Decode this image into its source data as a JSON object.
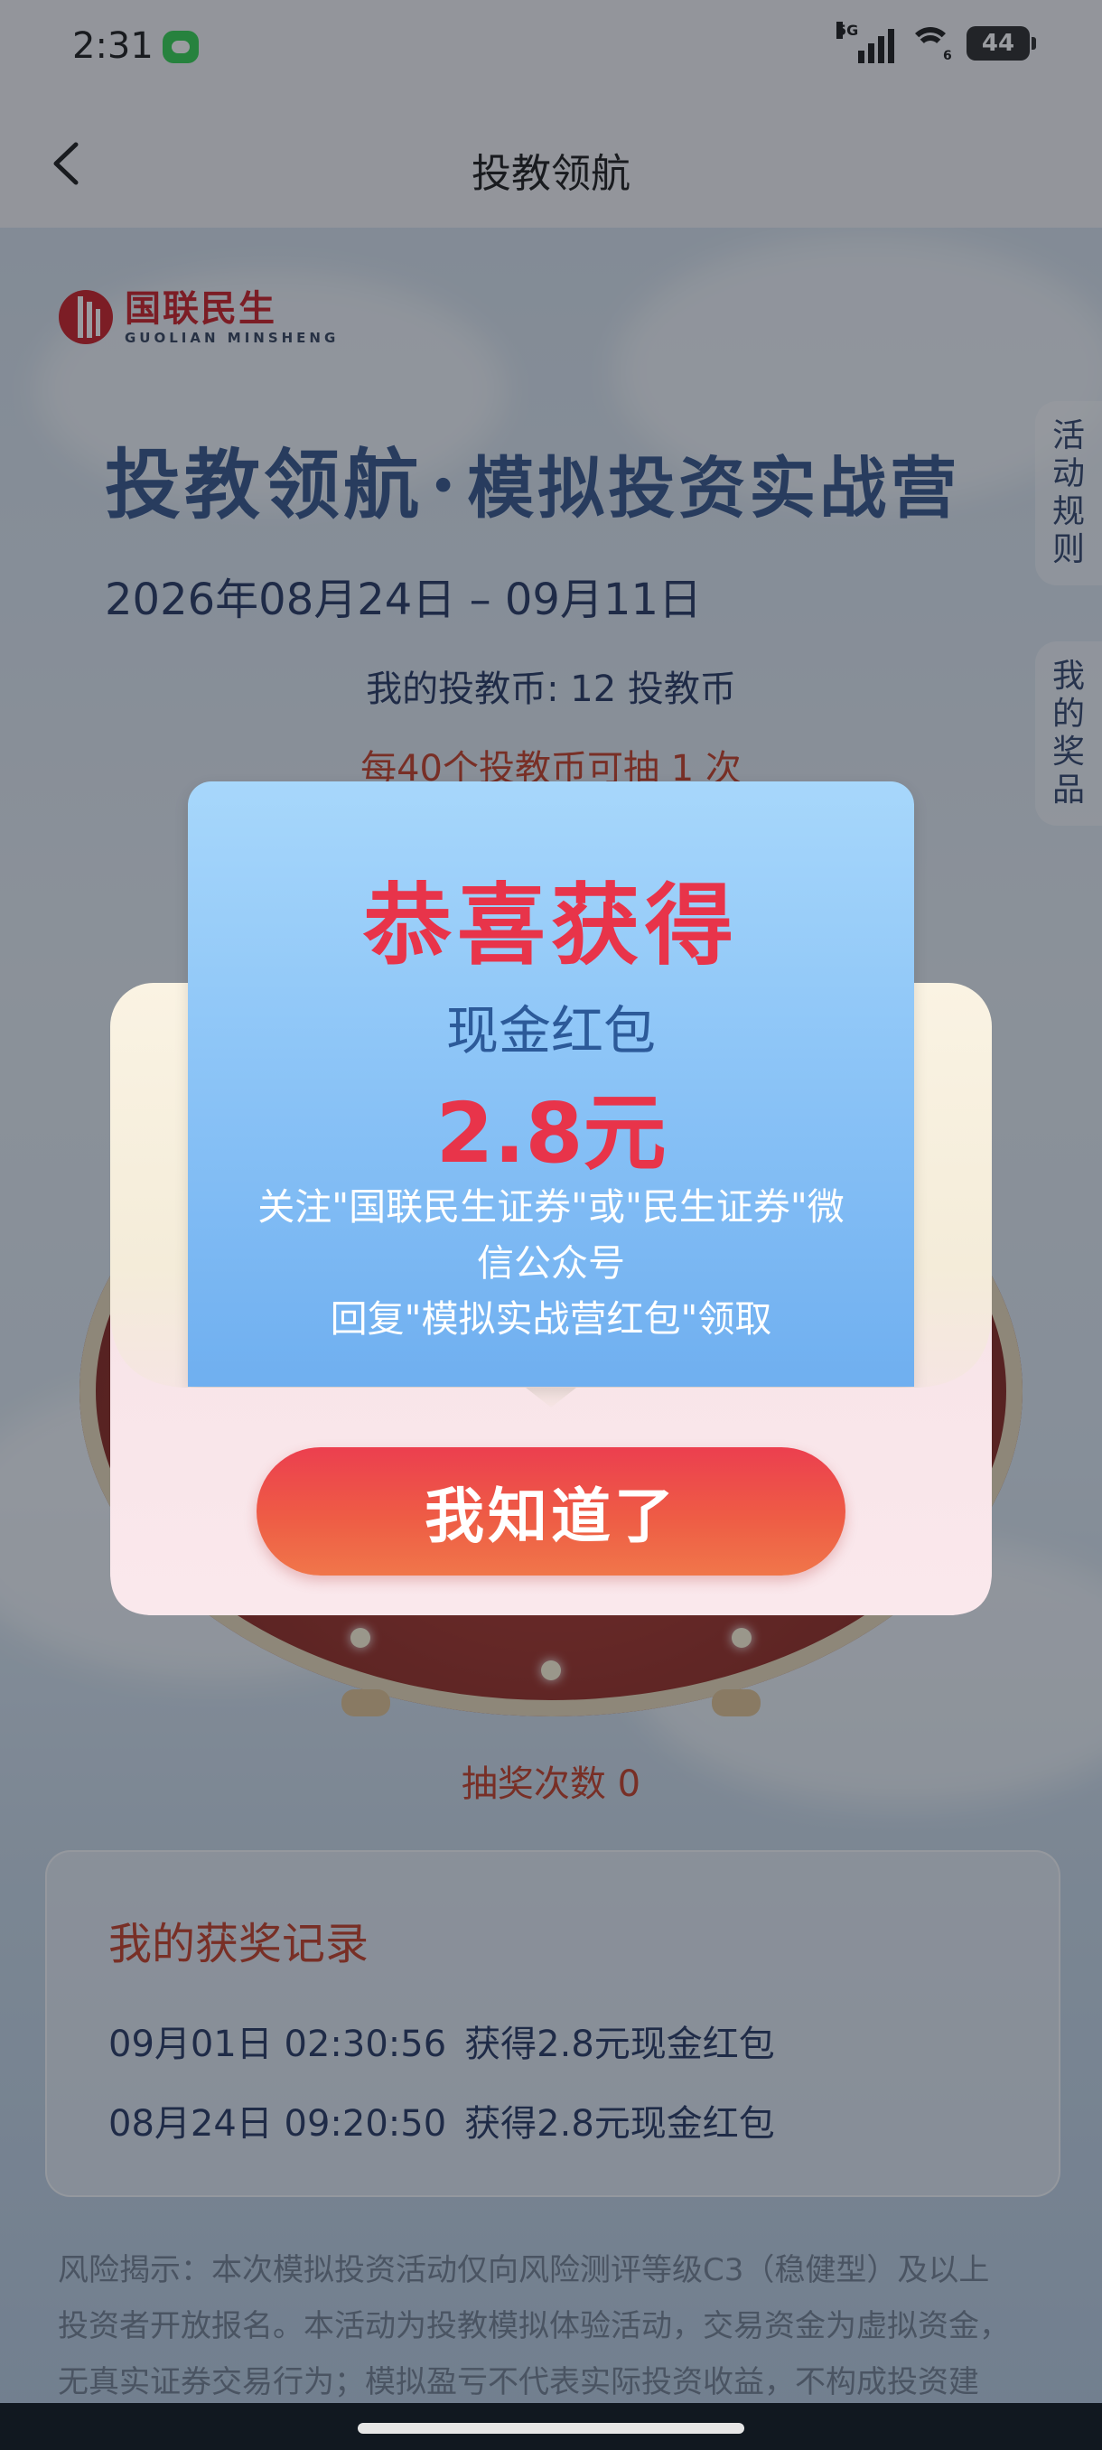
{
  "status_bar": {
    "time": "2:31",
    "network": "5G",
    "wifi_level": "6",
    "battery": "44"
  },
  "nav": {
    "title": "投教领航"
  },
  "brand": {
    "name_cn": "国联民生",
    "name_en": "GUOLIAN MINSHENG"
  },
  "hero": {
    "title_main": "投教领航",
    "title_sep": "·",
    "title_sub": "模拟投资实战营",
    "date_range": "2026年08月24日 – 09月11日"
  },
  "coins": {
    "text": "我的投教币: 12 投教币"
  },
  "draw_rule": "每40个投教币可抽 1 次",
  "side_tabs": {
    "rules": [
      "活",
      "动",
      "规",
      "则"
    ],
    "prizes": [
      "我",
      "的",
      "奖",
      "品"
    ]
  },
  "draw_count": "抽奖次数 0",
  "records": {
    "title": "我的获奖记录",
    "items": [
      {
        "time": "09月01日 02:30:56",
        "desc": "获得2.8元现金红包"
      },
      {
        "time": "08月24日 09:20:50",
        "desc": "获得2.8元现金红包"
      }
    ]
  },
  "risk": {
    "line1": "风险揭示：本次模拟投资活动仅向风险测评等级C3（稳健型）及以上",
    "line2": "投资者开放报名。本活动为投教模拟体验活动，交易资金为虚拟资金，",
    "line3": "无真实证券交易行为；模拟盈亏不代表实际投资收益，不构成投资建"
  },
  "modal": {
    "congrats": "恭喜获得",
    "prize_name": "现金红包",
    "prize_amount": "2.8元",
    "instruction_1": "关注\"国联民生证券\"或\"民生证券\"微",
    "instruction_2": "信公众号",
    "instruction_3": "回复\"模拟实战营红包\"领取",
    "button": "我知道了"
  },
  "colors": {
    "accent_red": "#e8344a",
    "navy": "#1c2f5c",
    "card_blue": "#8dc5f7"
  }
}
